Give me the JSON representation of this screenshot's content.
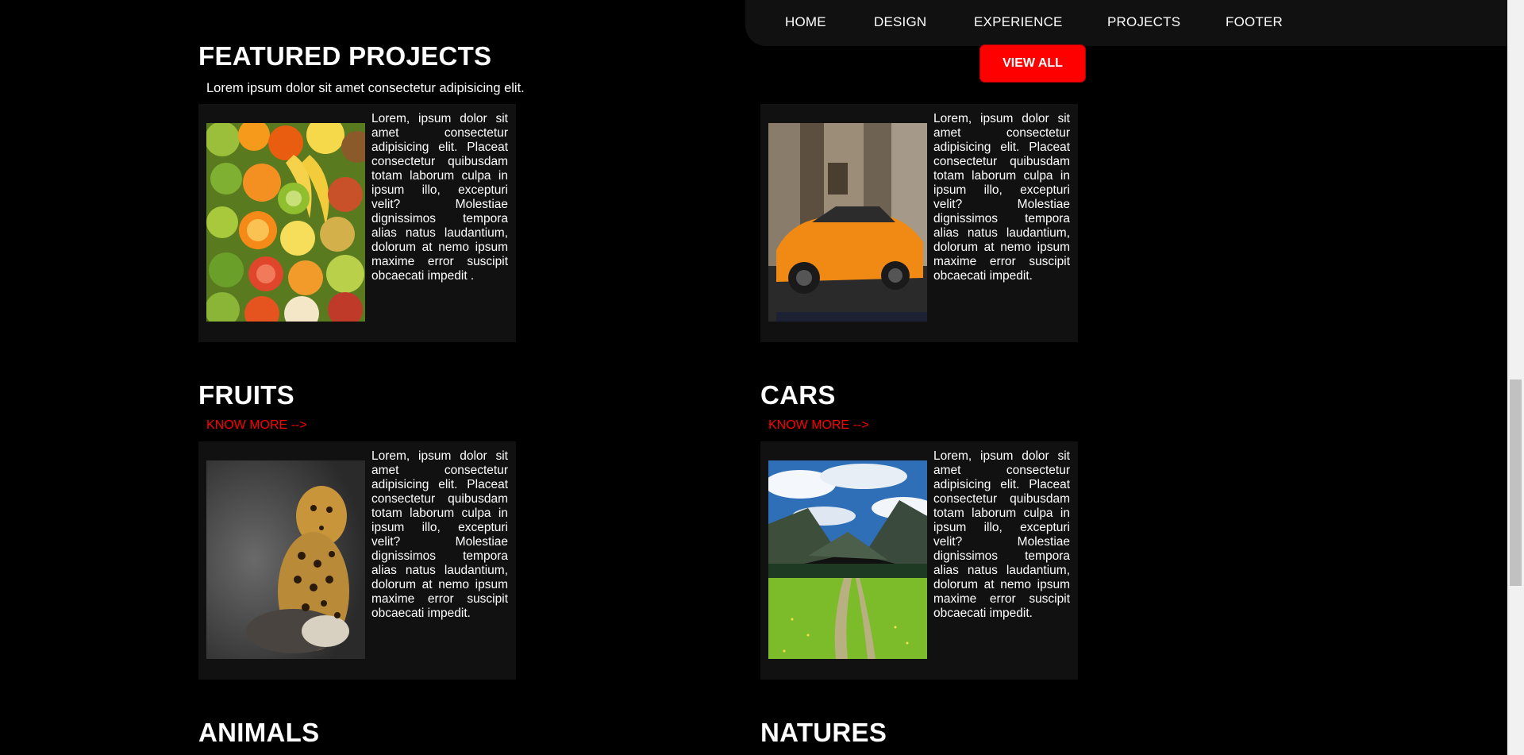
{
  "nav": {
    "items": [
      "HOME",
      "DESIGN",
      "EXPERIENCE",
      "PROJECTS",
      "FOOTER"
    ]
  },
  "featured": {
    "title": "FEATURED PROJECTS",
    "subtitle": "Lorem ipsum dolor sit amet consectetur adipisicing elit.",
    "view_all_label": "VIEW ALL"
  },
  "cards": [
    {
      "title": "FRUITS",
      "link_label": "KNOW MORE -->",
      "image": "fruits-image",
      "text": "Lorem, ipsum dolor sit amet consectetur adipisicing elit. Placeat consectetur quibusdam totam laborum culpa in ipsum illo, excepturi velit? Molestiae dignissimos tempora alias natus laudantium, dolorum at nemo ipsum maxime error suscipit obcaecati impedit ."
    },
    {
      "title": "CARS",
      "link_label": "KNOW MORE -->",
      "image": "car-image",
      "text": "Lorem, ipsum dolor sit amet consectetur adipisicing elit. Placeat consectetur quibusdam totam laborum culpa in ipsum illo, excepturi velit? Molestiae dignissimos tempora alias natus laudantium, dolorum at nemo ipsum maxime error suscipit obcaecati impedit."
    },
    {
      "title": "ANIMALS",
      "image": "leopard-image",
      "text": "Lorem, ipsum dolor sit amet consectetur adipisicing elit. Placeat consectetur quibusdam totam laborum culpa in ipsum illo, excepturi velit? Molestiae dignissimos tempora alias natus laudantium, dolorum at nemo ipsum maxime error suscipit obcaecati impedit."
    },
    {
      "title": "NATURES",
      "image": "landscape-image",
      "text": "Lorem, ipsum dolor sit amet consectetur adipisicing elit. Placeat consectetur quibusdam totam laborum culpa in ipsum illo, excepturi velit? Molestiae dignissimos tempora alias natus laudantium, dolorum at nemo ipsum maxime error suscipit obcaecati impedit."
    }
  ],
  "colors": {
    "background": "#000000",
    "card": "#111111",
    "accent": "#ff0000",
    "text": "#ffffff"
  }
}
